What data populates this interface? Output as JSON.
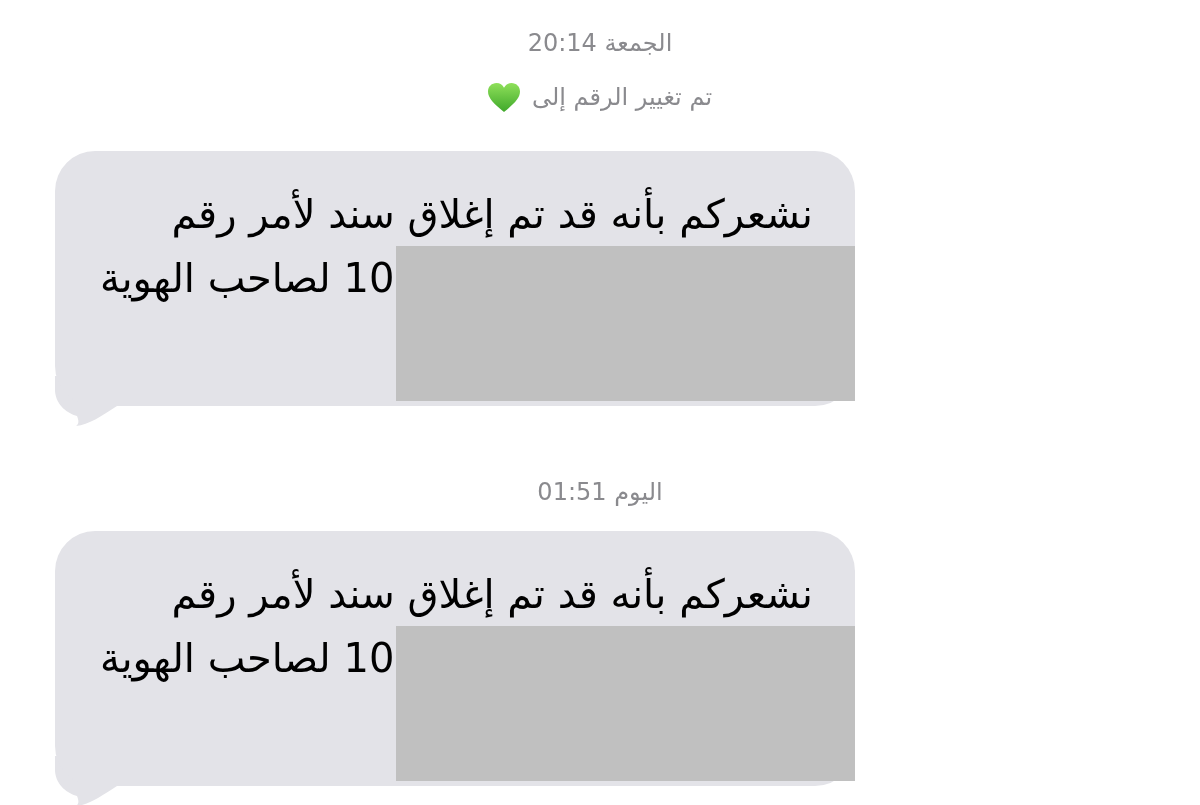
{
  "conversation": [
    {
      "kind": "timestamp",
      "text": "الجمعة 20:14"
    },
    {
      "kind": "notice",
      "text": "تم تغيير الرقم إلى"
    },
    {
      "kind": "message",
      "redacted": true,
      "lines": [
        "نشعركم بأنه قد تم إغلاق سند لأمر رقم",
        "10 لصاحب الهوية"
      ]
    },
    {
      "kind": "timestamp",
      "text": "اليوم 01:51"
    },
    {
      "kind": "message",
      "redacted": true,
      "lines": [
        "نشعركم بأنه قد تم إغلاق سند لأمر رقم",
        "10 لصاحب الهوية"
      ]
    }
  ]
}
